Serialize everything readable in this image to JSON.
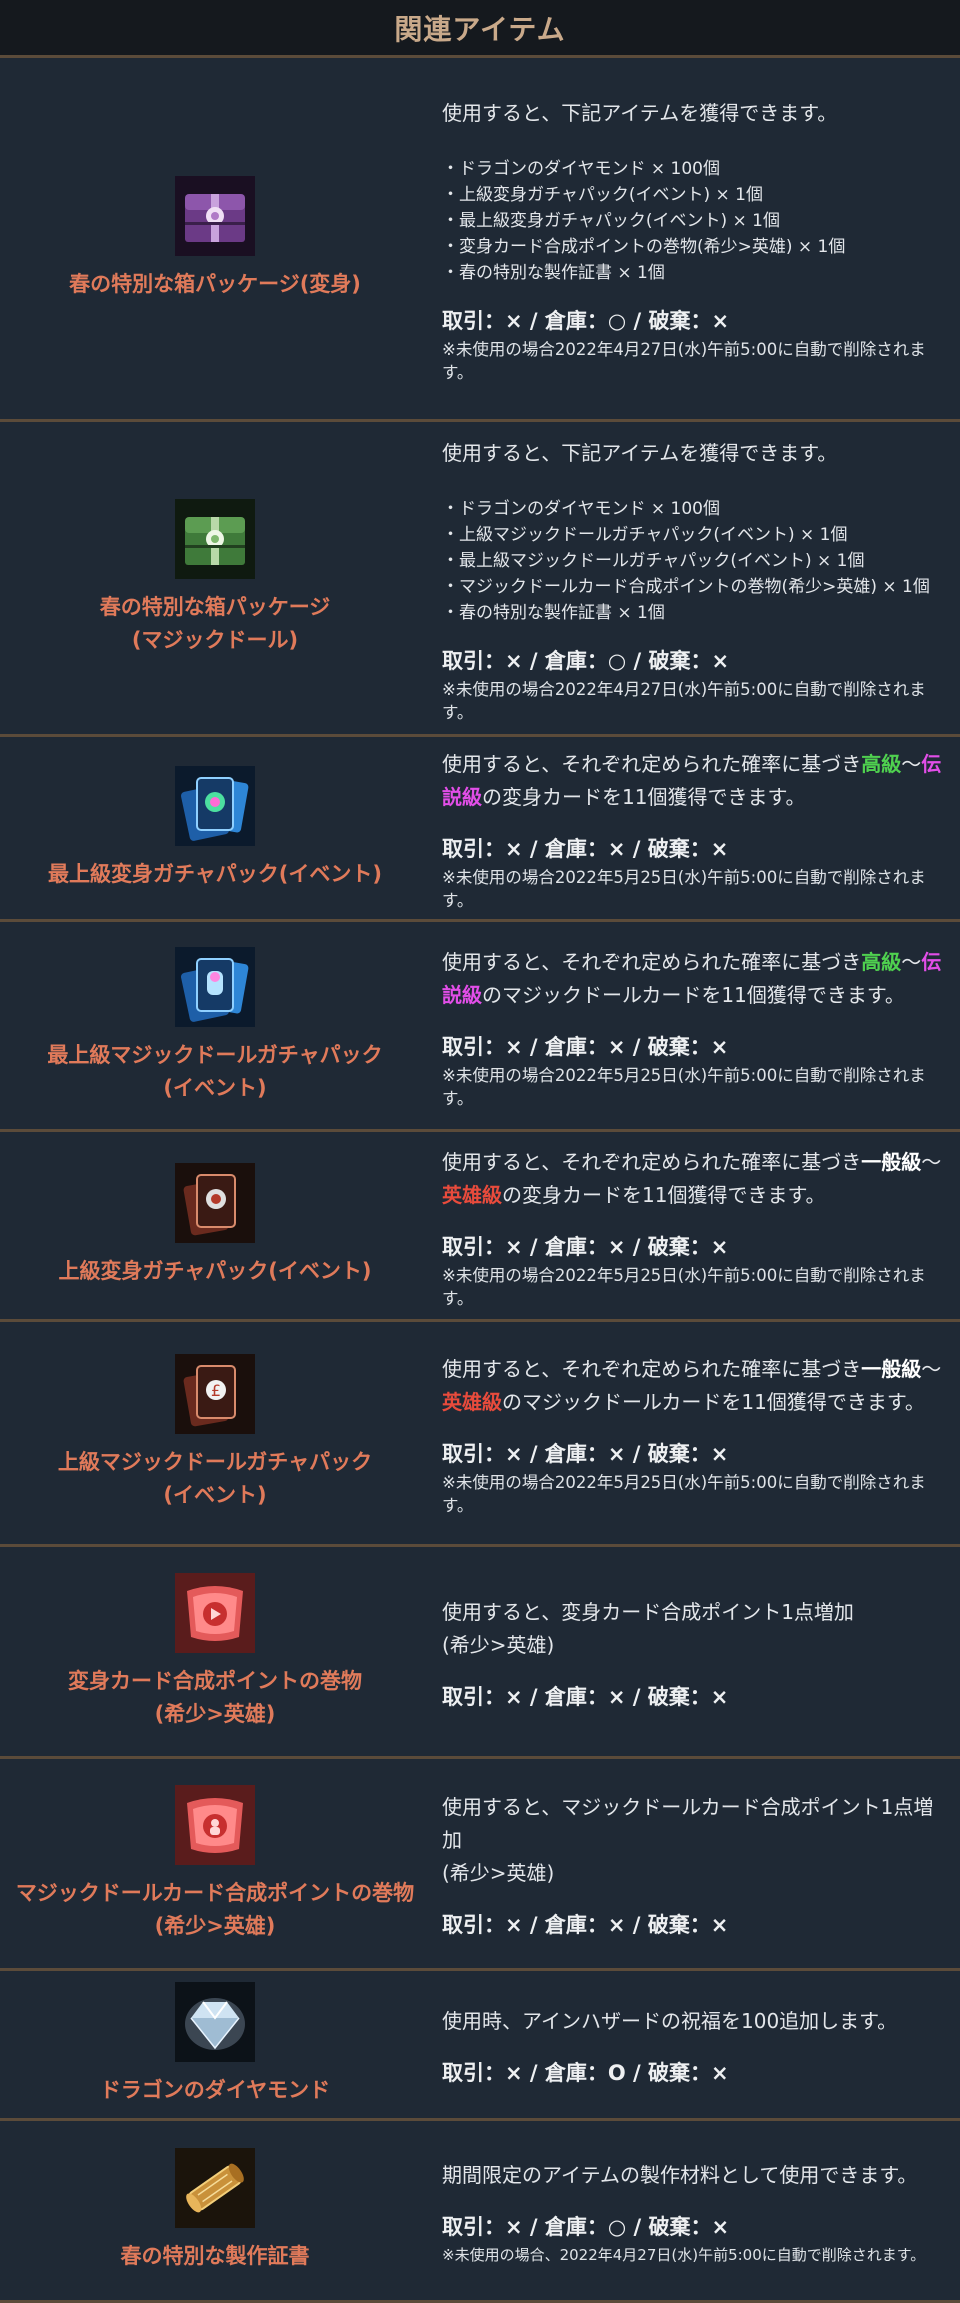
{
  "header": {
    "title": "関連アイテム"
  },
  "items": [
    {
      "name_lines": [
        "春の特別な箱パッケージ(変身)"
      ],
      "icon": "purple-chest-icon",
      "desc": "使用すると、下記アイテムを獲得できます。",
      "list": [
        "・ドラゴンのダイヤモンド × 100個",
        "・上級変身ガチャパック(イベント) × 1個",
        "・最上級変身ガチャパック(イベント) × 1個",
        "・変身カード合成ポイントの巻物(希少>英雄) × 1個",
        "・春の特別な製作証書 × 1個"
      ],
      "trade": "取引：× / 倉庫：○ / 破棄：×",
      "note": "※未使用の場合2022年4月27日(水)午前5:00に自動で削除されます。"
    },
    {
      "name_lines": [
        "春の特別な箱パッケージ",
        "(マジックドール)"
      ],
      "icon": "green-chest-icon",
      "desc": "使用すると、下記アイテムを獲得できます。",
      "list": [
        "・ドラゴンのダイヤモンド × 100個",
        "・上級マジックドールガチャパック(イベント) × 1個",
        "・最上級マジックドールガチャパック(イベント) × 1個",
        "・マジックドールカード合成ポイントの巻物(希少>英雄) × 1個",
        "・春の特別な製作証書 × 1個"
      ],
      "trade": "取引：× / 倉庫：○ / 破棄：×",
      "note": "※未使用の場合2022年4月27日(水)午前5:00に自動で削除されます。"
    },
    {
      "name_lines": [
        "最上級変身ガチャパック(イベント)"
      ],
      "icon": "blue-card-pack-icon",
      "desc_parts": [
        {
          "t": "使用すると、それぞれ定められた確率に基づき",
          "c": ""
        },
        {
          "t": "高級",
          "c": "g"
        },
        {
          "t": "～",
          "c": ""
        },
        {
          "t": "伝説級",
          "c": "m"
        },
        {
          "t": "の変身カードを11個獲得できます。",
          "c": ""
        }
      ],
      "trade": "取引：× / 倉庫：× / 破棄：×",
      "note": "※未使用の場合2022年5月25日(水)午前5:00に自動で削除されます。"
    },
    {
      "name_lines": [
        "最上級マジックドールガチャパック",
        "(イベント)"
      ],
      "icon": "blue-doll-pack-icon",
      "desc_parts": [
        {
          "t": "使用すると、それぞれ定められた確率に基づき",
          "c": ""
        },
        {
          "t": "高級",
          "c": "g"
        },
        {
          "t": "～",
          "c": ""
        },
        {
          "t": "伝説級",
          "c": "m"
        },
        {
          "t": "のマジックドールカードを11個獲得できます。",
          "c": ""
        }
      ],
      "trade": "取引：× / 倉庫：× / 破棄：×",
      "note": "※未使用の場合2022年5月25日(水)午前5:00に自動で削除されます。"
    },
    {
      "name_lines": [
        "上級変身ガチャパック(イベント)"
      ],
      "icon": "red-card-pack-icon",
      "desc_parts": [
        {
          "t": "使用すると、それぞれ定められた確率に基づき",
          "c": ""
        },
        {
          "t": "一般級",
          "c": "w"
        },
        {
          "t": "～",
          "c": ""
        },
        {
          "t": "英雄級",
          "c": "r"
        },
        {
          "t": "の変身カードを11個獲得できます。",
          "c": ""
        }
      ],
      "trade": "取引：× / 倉庫：× / 破棄：×",
      "note": "※未使用の場合2022年5月25日(水)午前5:00に自動で削除されます。"
    },
    {
      "name_lines": [
        "上級マジックドールガチャパック",
        "(イベント)"
      ],
      "icon": "red-doll-pack-icon",
      "desc_parts": [
        {
          "t": "使用すると、それぞれ定められた確率に基づき",
          "c": ""
        },
        {
          "t": "一般級",
          "c": "w"
        },
        {
          "t": "～",
          "c": ""
        },
        {
          "t": "英雄級",
          "c": "r"
        },
        {
          "t": "のマジックドールカードを11個獲得できます。",
          "c": ""
        }
      ],
      "trade": "取引：× / 倉庫：× / 破棄：×",
      "note": "※未使用の場合2022年5月25日(水)午前5:00に自動で削除されます。"
    },
    {
      "name_lines": [
        "変身カード合成ポイントの巻物",
        "(希少>英雄)"
      ],
      "icon": "red-scroll-icon",
      "desc_lines": [
        "使用すると、変身カード合成ポイント1点増加",
        "(希少>英雄)"
      ],
      "trade": "取引：× / 倉庫：× / 破棄：×"
    },
    {
      "name_lines": [
        "マジックドールカード合成ポイントの巻物",
        "(希少>英雄)"
      ],
      "icon": "red-doll-scroll-icon",
      "desc_lines": [
        "使用すると、マジックドールカード合成ポイント1点増加",
        "(希少>英雄)"
      ],
      "trade": "取引：× / 倉庫：× / 破棄：×"
    },
    {
      "name_lines": [
        "ドラゴンのダイヤモンド"
      ],
      "icon": "diamond-icon",
      "desc": "使用時、アインハザードの祝福を100追加します。",
      "trade": "取引：× / 倉庫：O / 破棄：×"
    },
    {
      "name_lines": [
        "春の特別な製作証書"
      ],
      "icon": "gold-scroll-icon",
      "desc": "期間限定のアイテムの製作材料として使用できます。",
      "trade": "取引：× / 倉庫：○ / 破棄：×",
      "note": "※未使用の場合、2022年4月27日(水)午前5:00に自動で削除されます。",
      "note_small": true
    }
  ]
}
